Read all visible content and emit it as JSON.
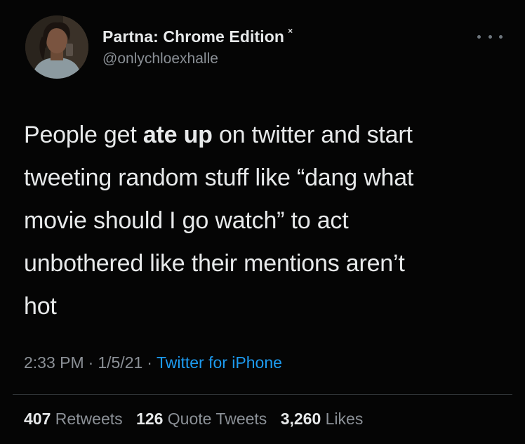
{
  "author": {
    "display_name": "Partna: Chrome Edition",
    "name_mark": "×",
    "handle": "@onlychloexhalle",
    "avatar_icon": "profile-photo"
  },
  "more_icon": "more-options-icon",
  "tweet": {
    "lines": [
      [
        "People get ",
        "ate up",
        " on twitter and start"
      ],
      [
        "tweeting random stuff like “dang what"
      ],
      [
        "movie should I go watch” to act"
      ],
      [
        "unbothered like their mentions aren’t"
      ],
      [
        "hot"
      ]
    ]
  },
  "meta": {
    "time": "2:33 PM",
    "sep1": "·",
    "date": "1/5/21",
    "sep2": "·",
    "source": "Twitter for iPhone"
  },
  "stats": {
    "retweets_count": "407",
    "retweets_label": "Retweets",
    "quotes_count": "126",
    "quotes_label": "Quote Tweets",
    "likes_count": "3,260",
    "likes_label": "Likes"
  },
  "colors": {
    "background": "#050505",
    "text": "#e7e9ea",
    "secondary": "#8b9096",
    "link": "#1d9bf0",
    "divider": "#2f3336"
  }
}
